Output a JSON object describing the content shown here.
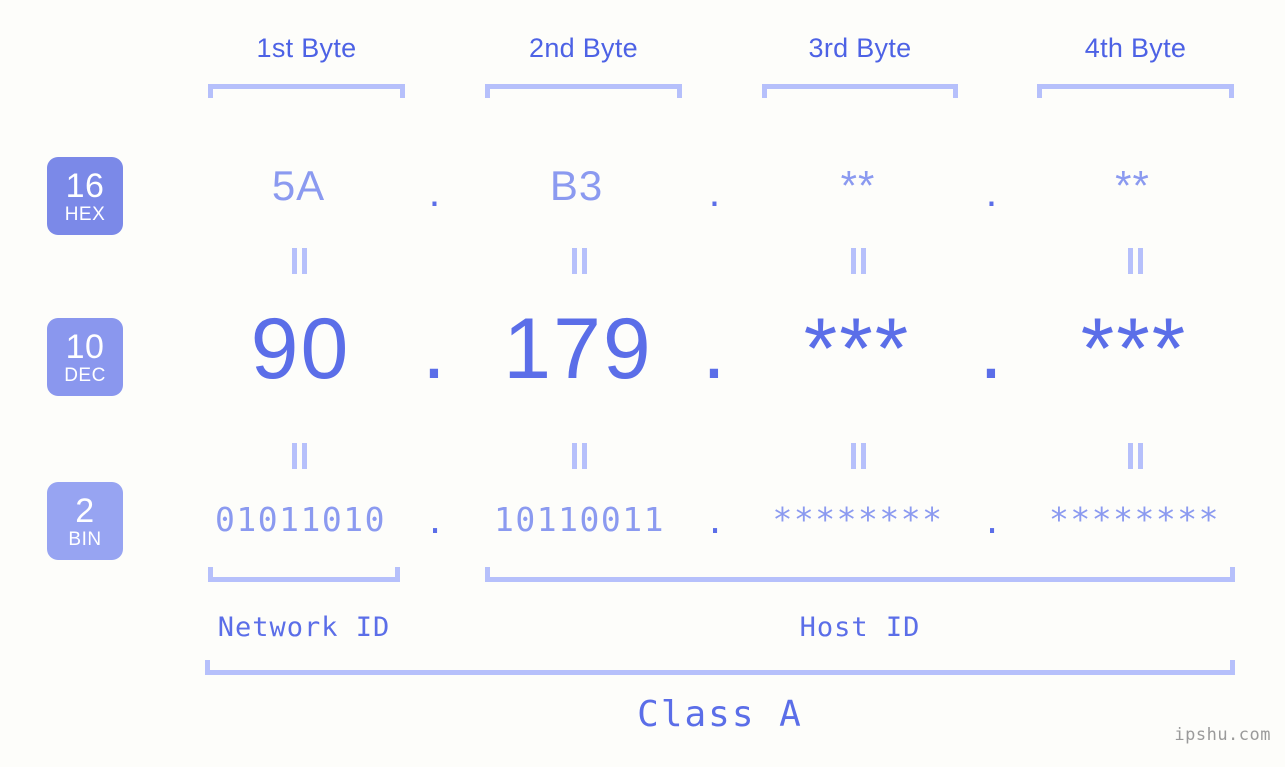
{
  "headers": [
    {
      "label": "1st Byte"
    },
    {
      "label": "2nd Byte"
    },
    {
      "label": "3rd Byte"
    },
    {
      "label": "4th Byte"
    }
  ],
  "bases": [
    {
      "num": "16",
      "name": "HEX",
      "color": "#7b89e8"
    },
    {
      "num": "10",
      "name": "DEC",
      "color": "#8a97ee"
    },
    {
      "num": "2",
      "name": "BIN",
      "color": "#97a4f2"
    }
  ],
  "rows": {
    "hex": {
      "base_num": "16",
      "base_name": "HEX",
      "values": [
        "5A",
        "B3",
        "**",
        "**"
      ],
      "separator": "."
    },
    "dec": {
      "base_num": "10",
      "base_name": "DEC",
      "values": [
        "90",
        "179",
        "***",
        "***"
      ],
      "separator": "."
    },
    "bin": {
      "base_num": "2",
      "base_name": "BIN",
      "values": [
        "01011010",
        "10110011",
        "********",
        "********"
      ],
      "separator": "."
    }
  },
  "connector": "||",
  "sections": [
    {
      "label": "Network ID"
    },
    {
      "label": "Host ID"
    }
  ],
  "class": {
    "label": "Class A"
  },
  "watermark": {
    "text": "ipshu.com"
  },
  "colors": {
    "background": "#fdfdfa",
    "accent_dark": "#5b6ee8",
    "accent_mid": "#8b9af0",
    "accent_light": "#b6c0fb",
    "badge_hex": "#7b89e8",
    "badge_dec": "#8a97ee",
    "badge_bin": "#97a4f2",
    "watermark": "#9a9a9a"
  }
}
